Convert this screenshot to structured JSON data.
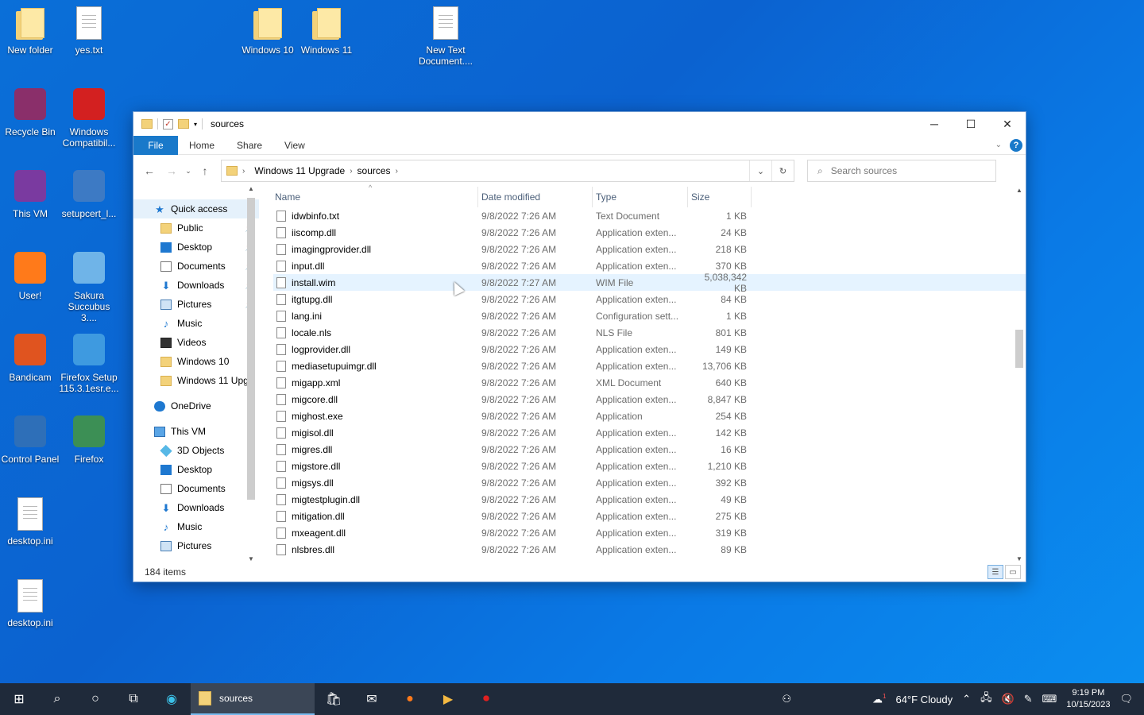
{
  "desktop": {
    "icons": [
      {
        "label": "New folder",
        "type": "folder"
      },
      {
        "label": "yes.txt",
        "type": "doc"
      },
      {
        "label": "Windows 10",
        "type": "folder"
      },
      {
        "label": "Windows 11",
        "type": "folder"
      },
      {
        "label": "New Text Document....",
        "type": "doc"
      },
      {
        "label": "Recycle Bin",
        "type": "app"
      },
      {
        "label": "Windows Compatibil...",
        "type": "app"
      },
      {
        "label": "This VM",
        "type": "app"
      },
      {
        "label": "setupcert_l...",
        "type": "app"
      },
      {
        "label": "User!",
        "type": "app"
      },
      {
        "label": "Sakura Succubus 3....",
        "type": "app"
      },
      {
        "label": "Bandicam",
        "type": "app"
      },
      {
        "label": "Firefox Setup 115.3.1esr.e...",
        "type": "app"
      },
      {
        "label": "Control Panel",
        "type": "app"
      },
      {
        "label": "Firefox",
        "type": "app"
      },
      {
        "label": "desktop.ini",
        "type": "doc"
      },
      {
        "label": "desktop.ini",
        "type": "doc"
      }
    ]
  },
  "window": {
    "title": "sources",
    "ribbon_tabs": [
      "File",
      "Home",
      "Share",
      "View"
    ],
    "breadcrumb": [
      "Windows 11 Upgrade",
      "sources"
    ],
    "search_placeholder": "Search sources",
    "columns": {
      "name": "Name",
      "date": "Date modified",
      "type": "Type",
      "size": "Size"
    },
    "status": "184 items"
  },
  "navpane": {
    "quick_access": "Quick access",
    "quick_items": [
      {
        "label": "Public",
        "icon": "folder-icon",
        "pinned": true
      },
      {
        "label": "Desktop",
        "icon": "desktop-icon",
        "pinned": true
      },
      {
        "label": "Documents",
        "icon": "documents-icon",
        "pinned": true
      },
      {
        "label": "Downloads",
        "icon": "downloads-icon",
        "pinned": true
      },
      {
        "label": "Pictures",
        "icon": "pictures-icon",
        "pinned": true
      },
      {
        "label": "Music",
        "icon": "music-icon",
        "pinned": false
      },
      {
        "label": "Videos",
        "icon": "videos-icon",
        "pinned": false
      },
      {
        "label": "Windows 10",
        "icon": "folder-icon",
        "pinned": false
      },
      {
        "label": "Windows 11 Upg",
        "icon": "folder-icon",
        "pinned": false
      }
    ],
    "onedrive": "OneDrive",
    "this_vm": "This VM",
    "vm_items": [
      {
        "label": "3D Objects",
        "icon": "3d-objects-icon"
      },
      {
        "label": "Desktop",
        "icon": "desktop-icon"
      },
      {
        "label": "Documents",
        "icon": "documents-icon"
      },
      {
        "label": "Downloads",
        "icon": "downloads-icon"
      },
      {
        "label": "Music",
        "icon": "music-icon"
      },
      {
        "label": "Pictures",
        "icon": "pictures-icon"
      }
    ]
  },
  "files": [
    {
      "name": "idwbinfo.txt",
      "date": "9/8/2022 7:26 AM",
      "type": "Text Document",
      "size": "1 KB"
    },
    {
      "name": "iiscomp.dll",
      "date": "9/8/2022 7:26 AM",
      "type": "Application exten...",
      "size": "24 KB"
    },
    {
      "name": "imagingprovider.dll",
      "date": "9/8/2022 7:26 AM",
      "type": "Application exten...",
      "size": "218 KB"
    },
    {
      "name": "input.dll",
      "date": "9/8/2022 7:26 AM",
      "type": "Application exten...",
      "size": "370 KB"
    },
    {
      "name": "install.wim",
      "date": "9/8/2022 7:27 AM",
      "type": "WIM File",
      "size": "5,038,342 KB"
    },
    {
      "name": "itgtupg.dll",
      "date": "9/8/2022 7:26 AM",
      "type": "Application exten...",
      "size": "84 KB"
    },
    {
      "name": "lang.ini",
      "date": "9/8/2022 7:26 AM",
      "type": "Configuration sett...",
      "size": "1 KB"
    },
    {
      "name": "locale.nls",
      "date": "9/8/2022 7:26 AM",
      "type": "NLS File",
      "size": "801 KB"
    },
    {
      "name": "logprovider.dll",
      "date": "9/8/2022 7:26 AM",
      "type": "Application exten...",
      "size": "149 KB"
    },
    {
      "name": "mediasetupuimgr.dll",
      "date": "9/8/2022 7:26 AM",
      "type": "Application exten...",
      "size": "13,706 KB"
    },
    {
      "name": "migapp.xml",
      "date": "9/8/2022 7:26 AM",
      "type": "XML Document",
      "size": "640 KB"
    },
    {
      "name": "migcore.dll",
      "date": "9/8/2022 7:26 AM",
      "type": "Application exten...",
      "size": "8,847 KB"
    },
    {
      "name": "mighost.exe",
      "date": "9/8/2022 7:26 AM",
      "type": "Application",
      "size": "254 KB"
    },
    {
      "name": "migisol.dll",
      "date": "9/8/2022 7:26 AM",
      "type": "Application exten...",
      "size": "142 KB"
    },
    {
      "name": "migres.dll",
      "date": "9/8/2022 7:26 AM",
      "type": "Application exten...",
      "size": "16 KB"
    },
    {
      "name": "migstore.dll",
      "date": "9/8/2022 7:26 AM",
      "type": "Application exten...",
      "size": "1,210 KB"
    },
    {
      "name": "migsys.dll",
      "date": "9/8/2022 7:26 AM",
      "type": "Application exten...",
      "size": "392 KB"
    },
    {
      "name": "migtestplugin.dll",
      "date": "9/8/2022 7:26 AM",
      "type": "Application exten...",
      "size": "49 KB"
    },
    {
      "name": "mitigation.dll",
      "date": "9/8/2022 7:26 AM",
      "type": "Application exten...",
      "size": "275 KB"
    },
    {
      "name": "mxeagent.dll",
      "date": "9/8/2022 7:26 AM",
      "type": "Application exten...",
      "size": "319 KB"
    },
    {
      "name": "nlsbres.dll",
      "date": "9/8/2022 7:26 AM",
      "type": "Application exten...",
      "size": "89 KB"
    }
  ],
  "taskbar": {
    "active_app": "sources",
    "weather": "64°F  Cloudy",
    "time": "9:19 PM",
    "date": "10/15/2023",
    "weather_badge": "1"
  }
}
